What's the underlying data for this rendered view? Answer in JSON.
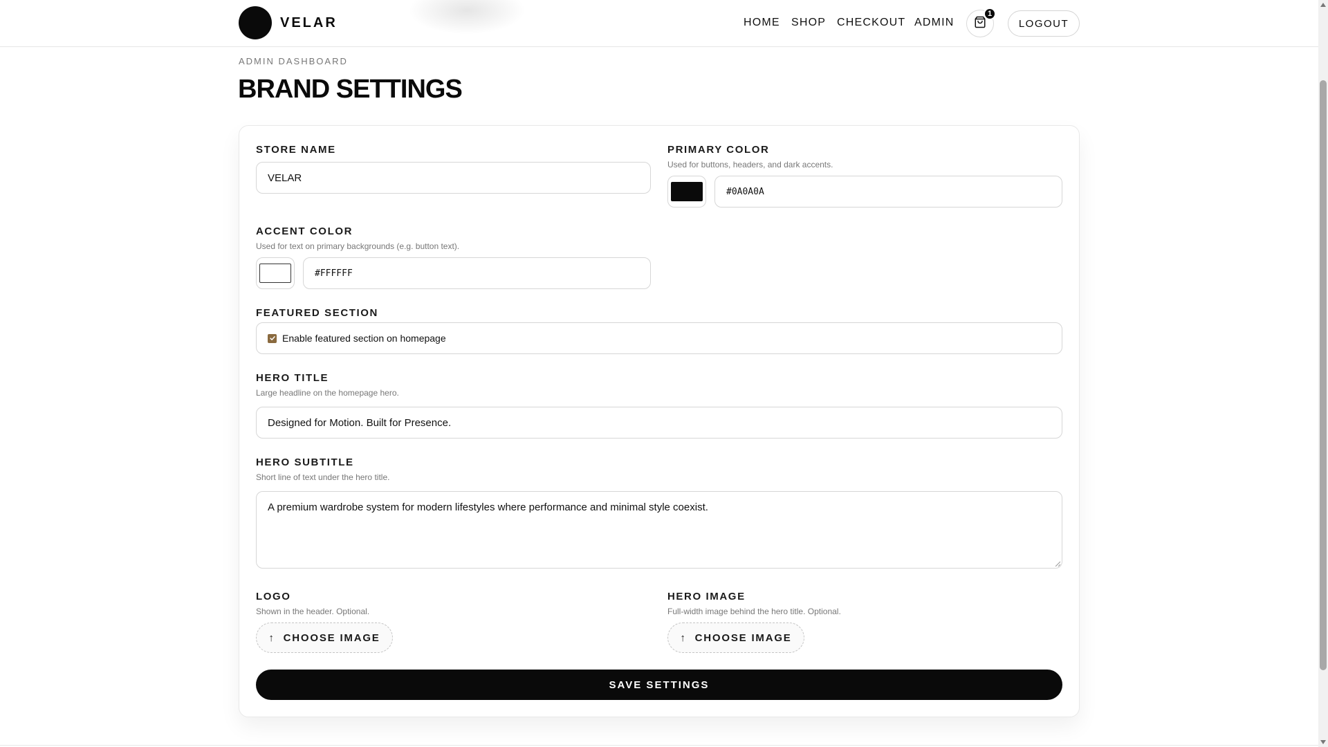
{
  "header": {
    "brand": "VELAR",
    "nav": [
      "HOME",
      "SHOP",
      "CHECKOUT",
      "ADMIN"
    ],
    "cart_count": "1",
    "logout_label": "LOGOUT"
  },
  "page": {
    "eyebrow": "ADMIN DASHBOARD",
    "title": "BRAND SETTINGS"
  },
  "form": {
    "store_name": {
      "label": "STORE NAME",
      "value": "VELAR"
    },
    "primary_color": {
      "label": "PRIMARY COLOR",
      "help": "Used for buttons, headers, and dark accents.",
      "value": "#0A0A0A",
      "swatch": "#0a0a0a"
    },
    "accent_color": {
      "label": "ACCENT COLOR",
      "help": "Used for text on primary backgrounds (e.g. button text).",
      "value": "#FFFFFF",
      "swatch": "#ffffff"
    },
    "featured": {
      "label": "FEATURED SECTION",
      "checkbox_label": "Enable featured section on homepage",
      "checked": true
    },
    "hero_title": {
      "label": "HERO TITLE",
      "help": "Large headline on the homepage hero.",
      "value": "Designed for Motion. Built for Presence."
    },
    "hero_subtitle": {
      "label": "HERO SUBTITLE",
      "help": "Short line of text under the hero title.",
      "value": "A premium wardrobe system for modern lifestyles where performance and minimal style coexist."
    },
    "logo": {
      "label": "LOGO",
      "help": "Shown in the header. Optional.",
      "button": "CHOOSE IMAGE"
    },
    "hero_image": {
      "label": "HERO IMAGE",
      "help": "Full-width image behind the hero title. Optional.",
      "button": "CHOOSE IMAGE"
    },
    "save_label": "SAVE SETTINGS"
  },
  "icons": {
    "cart": "shopping-bag-icon",
    "upload": "arrow-up-icon",
    "check": "checkmark-icon"
  },
  "colors": {
    "primary": "#0a0a0a",
    "checkbox_accent": "#8a6a3f"
  }
}
